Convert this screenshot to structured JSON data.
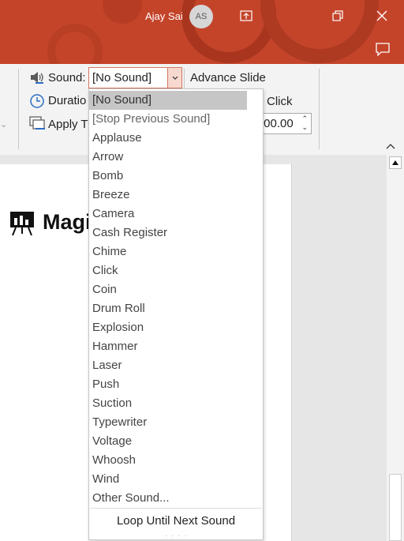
{
  "titlebar": {
    "user_name": "Ajay Sai",
    "avatar_initials": "AS",
    "accent_color": "#c4442a"
  },
  "ribbon": {
    "sound_label": "Sound:",
    "sound_value": "[No Sound]",
    "advance_slide_label": "Advance Slide",
    "duration_label": "Duratio",
    "on_click_label": "Click",
    "apply_label": "Apply T",
    "timing_value": ":00.00"
  },
  "slide": {
    "logo_text": "Magi"
  },
  "sound_menu": {
    "options": [
      "[No Sound]",
      "[Stop Previous Sound]",
      "Applause",
      "Arrow",
      "Bomb",
      "Breeze",
      "Camera",
      "Cash Register",
      "Chime",
      "Click",
      "Coin",
      "Drum Roll",
      "Explosion",
      "Hammer",
      "Laser",
      "Push",
      "Suction",
      "Typewriter",
      "Voltage",
      "Whoosh",
      "Wind",
      "Other Sound..."
    ],
    "selected": "[No Sound]",
    "loop_option": "Loop Until Next Sound"
  }
}
